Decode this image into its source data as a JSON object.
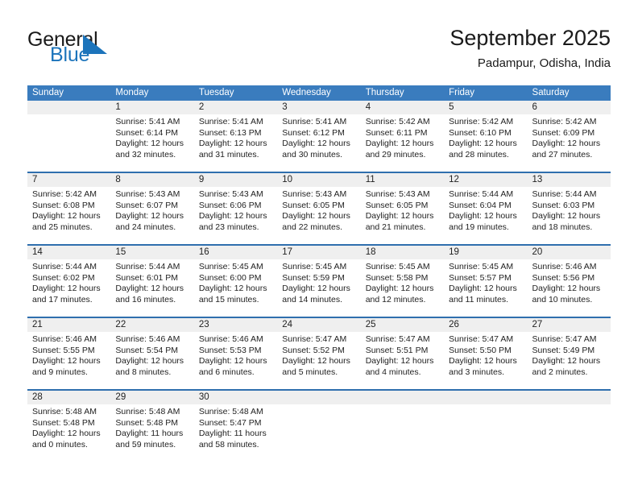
{
  "brand": {
    "name_part1": "General",
    "name_part2": "Blue",
    "accent_color": "#1c74bb",
    "logo_icon": "triangle-flag-icon"
  },
  "header": {
    "title": "September 2025",
    "subtitle": "Padampur, Odisha, India"
  },
  "calendar": {
    "header_bg": "#3a7cbe",
    "row_divider_color": "#2f6fae",
    "daynum_bg": "#efefef",
    "weekdays": [
      "Sunday",
      "Monday",
      "Tuesday",
      "Wednesday",
      "Thursday",
      "Friday",
      "Saturday"
    ],
    "weeks": [
      {
        "days": [
          {
            "num": "",
            "lines": []
          },
          {
            "num": "1",
            "lines": [
              "Sunrise: 5:41 AM",
              "Sunset: 6:14 PM",
              "Daylight: 12 hours",
              "and 32 minutes."
            ]
          },
          {
            "num": "2",
            "lines": [
              "Sunrise: 5:41 AM",
              "Sunset: 6:13 PM",
              "Daylight: 12 hours",
              "and 31 minutes."
            ]
          },
          {
            "num": "3",
            "lines": [
              "Sunrise: 5:41 AM",
              "Sunset: 6:12 PM",
              "Daylight: 12 hours",
              "and 30 minutes."
            ]
          },
          {
            "num": "4",
            "lines": [
              "Sunrise: 5:42 AM",
              "Sunset: 6:11 PM",
              "Daylight: 12 hours",
              "and 29 minutes."
            ]
          },
          {
            "num": "5",
            "lines": [
              "Sunrise: 5:42 AM",
              "Sunset: 6:10 PM",
              "Daylight: 12 hours",
              "and 28 minutes."
            ]
          },
          {
            "num": "6",
            "lines": [
              "Sunrise: 5:42 AM",
              "Sunset: 6:09 PM",
              "Daylight: 12 hours",
              "and 27 minutes."
            ]
          }
        ]
      },
      {
        "days": [
          {
            "num": "7",
            "lines": [
              "Sunrise: 5:42 AM",
              "Sunset: 6:08 PM",
              "Daylight: 12 hours",
              "and 25 minutes."
            ]
          },
          {
            "num": "8",
            "lines": [
              "Sunrise: 5:43 AM",
              "Sunset: 6:07 PM",
              "Daylight: 12 hours",
              "and 24 minutes."
            ]
          },
          {
            "num": "9",
            "lines": [
              "Sunrise: 5:43 AM",
              "Sunset: 6:06 PM",
              "Daylight: 12 hours",
              "and 23 minutes."
            ]
          },
          {
            "num": "10",
            "lines": [
              "Sunrise: 5:43 AM",
              "Sunset: 6:05 PM",
              "Daylight: 12 hours",
              "and 22 minutes."
            ]
          },
          {
            "num": "11",
            "lines": [
              "Sunrise: 5:43 AM",
              "Sunset: 6:05 PM",
              "Daylight: 12 hours",
              "and 21 minutes."
            ]
          },
          {
            "num": "12",
            "lines": [
              "Sunrise: 5:44 AM",
              "Sunset: 6:04 PM",
              "Daylight: 12 hours",
              "and 19 minutes."
            ]
          },
          {
            "num": "13",
            "lines": [
              "Sunrise: 5:44 AM",
              "Sunset: 6:03 PM",
              "Daylight: 12 hours",
              "and 18 minutes."
            ]
          }
        ]
      },
      {
        "days": [
          {
            "num": "14",
            "lines": [
              "Sunrise: 5:44 AM",
              "Sunset: 6:02 PM",
              "Daylight: 12 hours",
              "and 17 minutes."
            ]
          },
          {
            "num": "15",
            "lines": [
              "Sunrise: 5:44 AM",
              "Sunset: 6:01 PM",
              "Daylight: 12 hours",
              "and 16 minutes."
            ]
          },
          {
            "num": "16",
            "lines": [
              "Sunrise: 5:45 AM",
              "Sunset: 6:00 PM",
              "Daylight: 12 hours",
              "and 15 minutes."
            ]
          },
          {
            "num": "17",
            "lines": [
              "Sunrise: 5:45 AM",
              "Sunset: 5:59 PM",
              "Daylight: 12 hours",
              "and 14 minutes."
            ]
          },
          {
            "num": "18",
            "lines": [
              "Sunrise: 5:45 AM",
              "Sunset: 5:58 PM",
              "Daylight: 12 hours",
              "and 12 minutes."
            ]
          },
          {
            "num": "19",
            "lines": [
              "Sunrise: 5:45 AM",
              "Sunset: 5:57 PM",
              "Daylight: 12 hours",
              "and 11 minutes."
            ]
          },
          {
            "num": "20",
            "lines": [
              "Sunrise: 5:46 AM",
              "Sunset: 5:56 PM",
              "Daylight: 12 hours",
              "and 10 minutes."
            ]
          }
        ]
      },
      {
        "days": [
          {
            "num": "21",
            "lines": [
              "Sunrise: 5:46 AM",
              "Sunset: 5:55 PM",
              "Daylight: 12 hours",
              "and 9 minutes."
            ]
          },
          {
            "num": "22",
            "lines": [
              "Sunrise: 5:46 AM",
              "Sunset: 5:54 PM",
              "Daylight: 12 hours",
              "and 8 minutes."
            ]
          },
          {
            "num": "23",
            "lines": [
              "Sunrise: 5:46 AM",
              "Sunset: 5:53 PM",
              "Daylight: 12 hours",
              "and 6 minutes."
            ]
          },
          {
            "num": "24",
            "lines": [
              "Sunrise: 5:47 AM",
              "Sunset: 5:52 PM",
              "Daylight: 12 hours",
              "and 5 minutes."
            ]
          },
          {
            "num": "25",
            "lines": [
              "Sunrise: 5:47 AM",
              "Sunset: 5:51 PM",
              "Daylight: 12 hours",
              "and 4 minutes."
            ]
          },
          {
            "num": "26",
            "lines": [
              "Sunrise: 5:47 AM",
              "Sunset: 5:50 PM",
              "Daylight: 12 hours",
              "and 3 minutes."
            ]
          },
          {
            "num": "27",
            "lines": [
              "Sunrise: 5:47 AM",
              "Sunset: 5:49 PM",
              "Daylight: 12 hours",
              "and 2 minutes."
            ]
          }
        ]
      },
      {
        "days": [
          {
            "num": "28",
            "lines": [
              "Sunrise: 5:48 AM",
              "Sunset: 5:48 PM",
              "Daylight: 12 hours",
              "and 0 minutes."
            ]
          },
          {
            "num": "29",
            "lines": [
              "Sunrise: 5:48 AM",
              "Sunset: 5:48 PM",
              "Daylight: 11 hours",
              "and 59 minutes."
            ]
          },
          {
            "num": "30",
            "lines": [
              "Sunrise: 5:48 AM",
              "Sunset: 5:47 PM",
              "Daylight: 11 hours",
              "and 58 minutes."
            ]
          },
          {
            "num": "",
            "lines": []
          },
          {
            "num": "",
            "lines": []
          },
          {
            "num": "",
            "lines": []
          },
          {
            "num": "",
            "lines": []
          }
        ]
      }
    ]
  }
}
